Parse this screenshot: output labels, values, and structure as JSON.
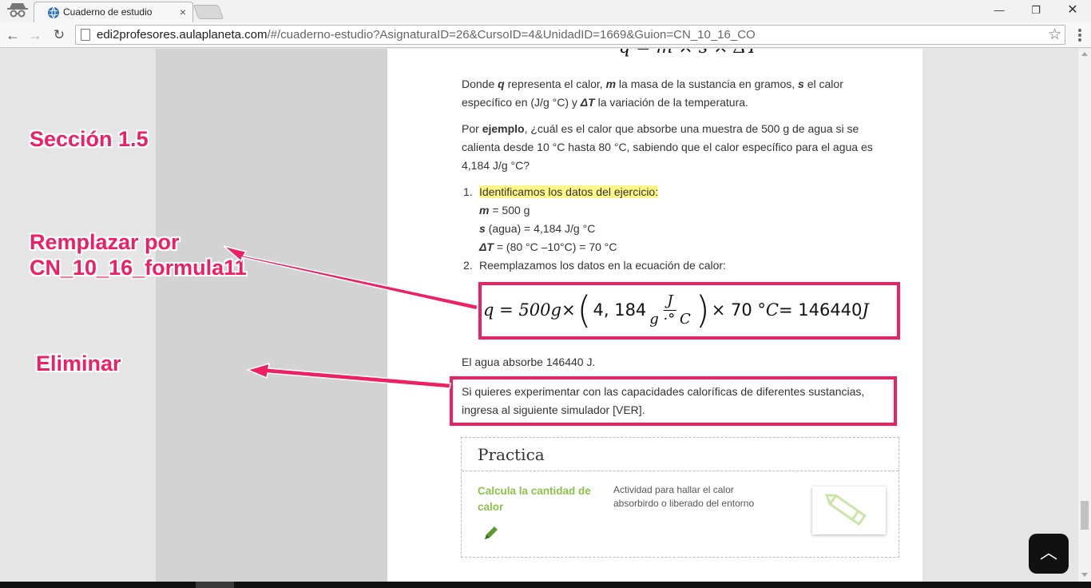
{
  "browser": {
    "tab_title": "Cuaderno de estudio",
    "tab_close": "×",
    "url_host": "edi2profesores.aulaplaneta.com",
    "url_rest": "/#/cuaderno-estudio?AsignaturaID=26&CursoID=4&UnidadID=1669&Guion=CN_10_16_CO",
    "window_minimize": "—",
    "window_restore": "❐",
    "window_close": "✕",
    "back": "←",
    "forward": "→",
    "reload": "↻",
    "star": "☆"
  },
  "content": {
    "formula_top": "q = m × s × ΔT",
    "intro": {
      "t1": "Donde ",
      "q": "q",
      "t2": " representa el calor, ",
      "m": "m",
      "t3": " la masa de la sustancia en gramos, ",
      "s": "s",
      "t4": " el calor específico en (J/g °C) y ",
      "dt": "ΔT",
      "t5": " la variación de la temperatura."
    },
    "example": {
      "t1": "Por ",
      "bold": "ejemplo",
      "t2": ", ¿cuál es el calor que absorbe una muestra de 500 g de agua si se calienta desde 10 °C hasta 80 °C, sabiendo que el calor específico para el agua es 4,184 J/g °C?"
    },
    "steps": [
      {
        "num": "1.",
        "label": "Identificamos los datos del ejercicio:",
        "data": [
          {
            "var": "m",
            "text": " = 500 g"
          },
          {
            "var": "s",
            "text": " (agua) = 4,184 J/g °C"
          },
          {
            "var": "ΔT",
            "text": " = (80 °C –10°C) = 70 °C"
          }
        ]
      },
      {
        "num": "2.",
        "label": "Reemplazamos los datos en la ecuación de calor:"
      }
    ],
    "equation": {
      "lhs": "q = 500 ",
      "g": "g",
      "times1": " × ",
      "paren_open": "(",
      "coef": "4, 184",
      "frac_num": "J",
      "frac_den": "g ·° C",
      "paren_close": ")",
      "rest": " × 70 °",
      "c": "C",
      "eq": " = 146440 ",
      "j": "J"
    },
    "result": "El agua absorbe 146440 J.",
    "simulator": "Si quieres experimentar con las capacidades caloríficas de diferentes sustancias, ingresa al siguiente simulador [VER]."
  },
  "practica": {
    "title": "Practica",
    "name": "Calcula la cantidad de calor",
    "description": "Actividad para hallar el calor absorbirdo o liberado del entorno"
  },
  "annotations": {
    "section": "Sección 1.5",
    "replace_line1": "Remplazar por",
    "replace_line2": "CN_10_16_formula11",
    "delete": "Eliminar",
    "color": "#ee1f63"
  },
  "scroll_top_button": "︿"
}
